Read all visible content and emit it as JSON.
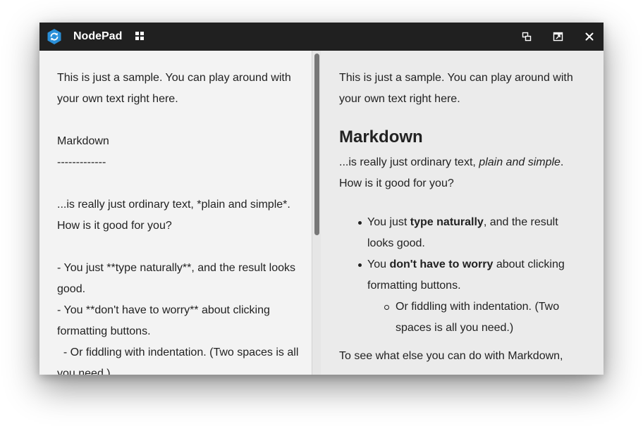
{
  "app": {
    "title": "NodePad",
    "colors": {
      "titlebar": "#202020",
      "logo": "#2a8fd8",
      "editor_bg": "#f3f3f3",
      "preview_bg": "#ebebeb",
      "text": "#222222"
    }
  },
  "titlebar": {
    "icons": [
      "app-logo-icon",
      "grid-icon",
      "restore-icon",
      "popout-icon",
      "close-icon"
    ]
  },
  "editor": {
    "text": "This is just a sample. You can play around with your own text right here.\n\nMarkdown\n-------------\n\n...is really just ordinary text, *plain and simple*. How is it good for you?\n\n- You just **type naturally**, and the result looks good.\n- You **don't have to worry** about clicking formatting buttons.\n  - Or fiddling with indentation. (Two spaces is all you need.)"
  },
  "preview": {
    "intro": "This is just a sample. You can play around with your own text right here.",
    "heading": "Markdown",
    "para_start": "...is really just ordinary text, ",
    "para_italic": "plain and simple",
    "para_end": ". How is it good for you?",
    "bullet1_start": "You just ",
    "bullet1_bold": "type naturally",
    "bullet1_end": ", and the result looks good.",
    "bullet2_start": "You ",
    "bullet2_bold": "don't have to worry",
    "bullet2_end": " about clicking formatting buttons.",
    "sub_bullet": "Or fiddling with indentation. (Two spaces is all you need.)",
    "last_line": "To see what else you can do with Markdown,"
  }
}
